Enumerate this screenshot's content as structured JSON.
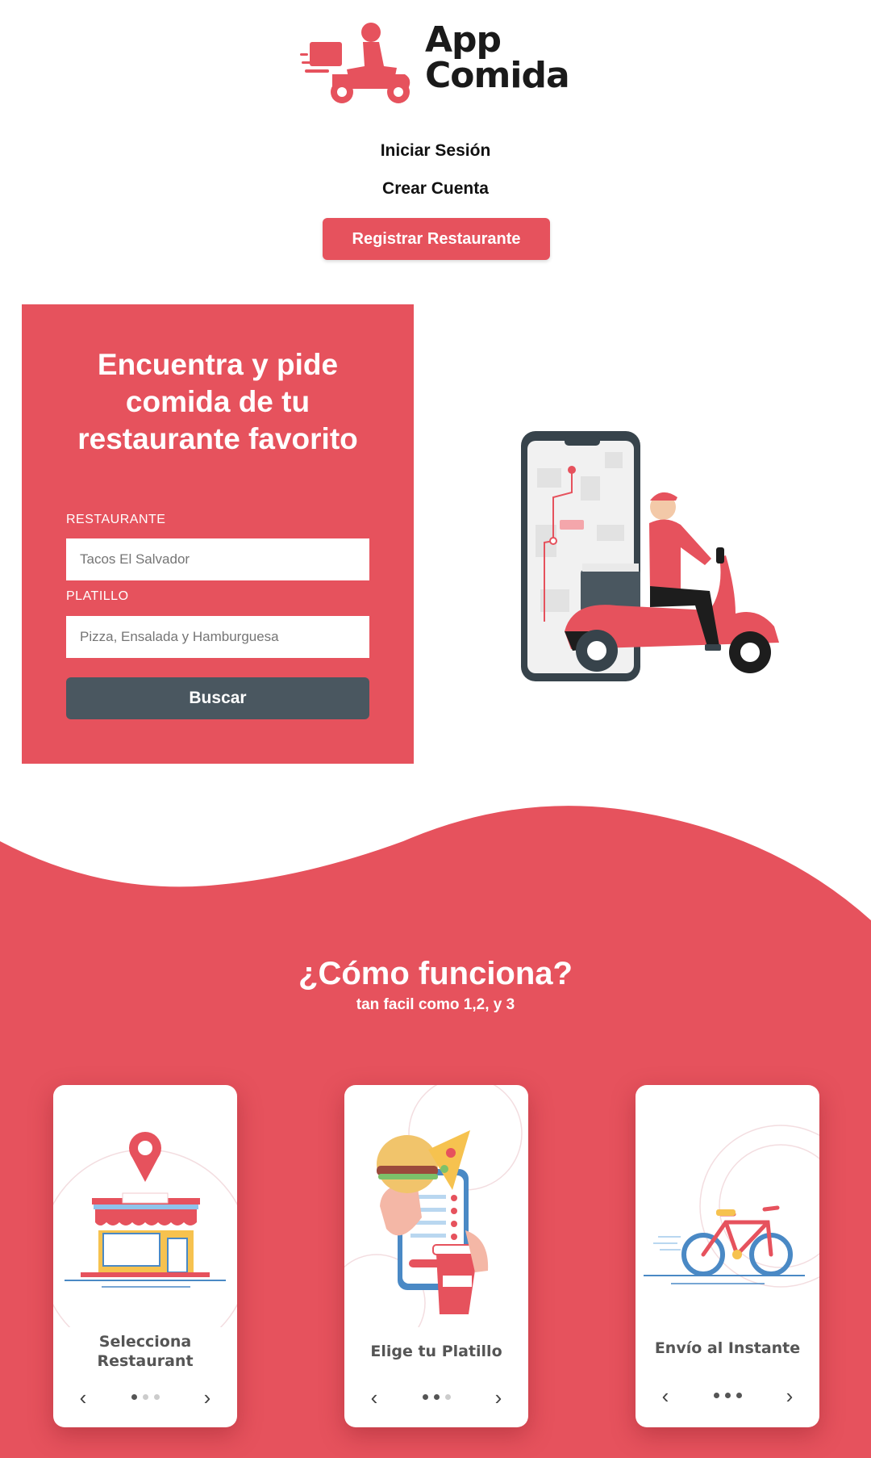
{
  "brand": {
    "name_line1": "App",
    "name_line2": "Comida",
    "accent": "#e6525d",
    "dark": "#4a5760",
    "logo_icon": "delivery-scooter-icon"
  },
  "nav": {
    "login": "Iniciar Sesión",
    "signup": "Crear Cuenta",
    "register_restaurant": "Registrar Restaurante"
  },
  "search": {
    "title_line1": "Encuentra y pide",
    "title_line2": "comida de tu",
    "title_line3": "restaurante favorito",
    "restaurant_label": "RESTAURANTE",
    "restaurant_placeholder": "Tacos El Salvador",
    "dish_label": "PLATILLO",
    "dish_placeholder": "Pizza, Ensalada y Hamburguesa",
    "button": "Buscar"
  },
  "how": {
    "title": "¿Cómo funciona?",
    "subtitle": "tan facil como 1,2, y 3",
    "steps": [
      {
        "title_line1": "Selecciona",
        "title_line2": "Restaurant",
        "active_dot": 1,
        "icon": "storefront-icon"
      },
      {
        "title_line1": "Elige tu Platillo",
        "title_line2": "",
        "active_dot": 2,
        "icon": "food-menu-icon"
      },
      {
        "title_line1": "Envío al Instante",
        "title_line2": "",
        "active_dot": 3,
        "icon": "bicycle-icon"
      }
    ]
  }
}
